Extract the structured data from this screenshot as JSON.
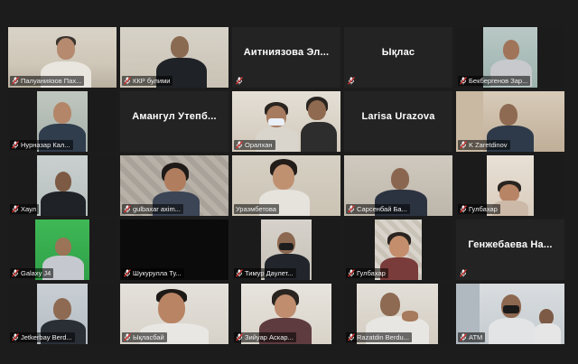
{
  "window": {
    "view": "gallery"
  },
  "colors": {
    "active_speaker_border": "#d8d872",
    "tile_background": "#232323",
    "muted_mic": "#e03232"
  },
  "participants": [
    {
      "label": "Палуаниязов Пах...",
      "video": true,
      "muted": true
    },
    {
      "label": "ККР булими",
      "video": true,
      "muted": true
    },
    {
      "name": "Аитниязова Эл...",
      "label": "Аитниязова Эл...",
      "video": false,
      "muted": true
    },
    {
      "name": "Ықлас",
      "label": "Ықлас",
      "video": false,
      "muted": true
    },
    {
      "label": "Бекбергенов Зар...",
      "video": true,
      "muted": true
    },
    {
      "label": "Нурназар Кал...",
      "video": true,
      "muted": true
    },
    {
      "name": "Амангул Утепб...",
      "label": "Амангул Утепб...",
      "video": false,
      "muted": true
    },
    {
      "label": "Оралхан",
      "video": true,
      "muted": true
    },
    {
      "name": "Larisa Urazova",
      "label": "Larisa Urazova",
      "video": false,
      "muted": true
    },
    {
      "label": "K Zaretdinov",
      "video": true,
      "muted": true
    },
    {
      "label": "Хаул",
      "video": true,
      "muted": true
    },
    {
      "label": "gulbaxar axim...",
      "video": true,
      "muted": true
    },
    {
      "label": "Уразмбетова",
      "video": true,
      "muted": false,
      "active": true
    },
    {
      "label": "Сарсенбай Ба...",
      "video": true,
      "muted": true
    },
    {
      "label": "Гулбахар",
      "video": true,
      "muted": true
    },
    {
      "label": "Galaxy J4",
      "video": true,
      "muted": true
    },
    {
      "label": "Шукурулла Ту...",
      "video": true,
      "muted": true
    },
    {
      "label": "Тимур Даулет...",
      "video": true,
      "muted": true
    },
    {
      "label": "Гулбахар",
      "video": true,
      "muted": true
    },
    {
      "name": "Генжебаева На...",
      "label": "Генжебаева На...",
      "video": false,
      "muted": true
    },
    {
      "label": "Jetkerbay Berd...",
      "video": true,
      "muted": true
    },
    {
      "label": "Ықласбай",
      "video": true,
      "muted": true
    },
    {
      "label": "Зийуар Аскар...",
      "video": true,
      "muted": true
    },
    {
      "label": "Razatdin Berdu...",
      "video": true,
      "muted": true
    },
    {
      "label": "ATM",
      "video": true,
      "muted": true
    }
  ]
}
